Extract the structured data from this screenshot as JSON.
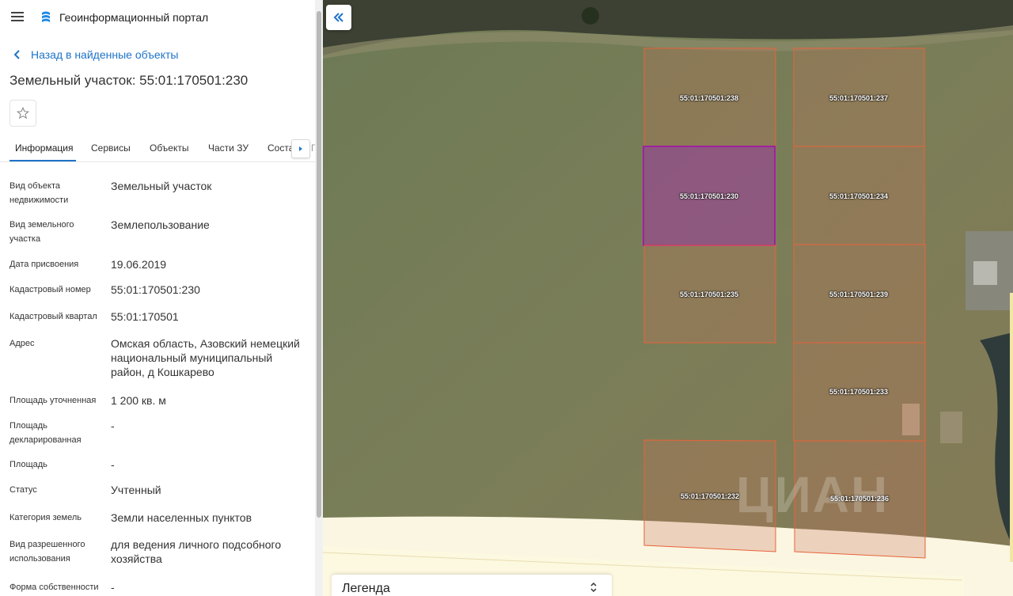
{
  "header": {
    "app_title": "Геоинформационный портал"
  },
  "nav": {
    "back_label": "Назад в найденные объекты"
  },
  "object": {
    "title": "Земельный участок: 55:01:170501:230"
  },
  "tabs": [
    {
      "label": "Информация",
      "active": true
    },
    {
      "label": "Сервисы"
    },
    {
      "label": "Объекты"
    },
    {
      "label": "Части ЗУ"
    },
    {
      "label": "Соста"
    }
  ],
  "tab_peek": "Г",
  "properties": [
    {
      "label": "Вид объекта недвижимости",
      "value": "Земельный участок"
    },
    {
      "label": "Вид земельного участка",
      "value": "Землепользование"
    },
    {
      "label": "Дата присвоения",
      "value": "19.06.2019"
    },
    {
      "label": "Кадастровый номер",
      "value": "55:01:170501:230"
    },
    {
      "label": "Кадастровый квартал",
      "value": "55:01:170501"
    },
    {
      "label": "Адрес",
      "value": "Омская область, Азовский немецкий национальный муниципальный район, д Кошкарево"
    },
    {
      "label": "Площадь уточненная",
      "value": "1 200 кв. м"
    },
    {
      "label": "Площадь декларированная",
      "value": "-"
    },
    {
      "label": "Площадь",
      "value": "-"
    },
    {
      "label": "Статус",
      "value": "Учтенный"
    },
    {
      "label": "Категория земель",
      "value": "Земли населенных пунктов"
    },
    {
      "label": "Вид разрешенного использования",
      "value": "для ведения личного подсобного хозяйства"
    },
    {
      "label": "Форма собственности",
      "value": "-"
    }
  ],
  "parcels": [
    {
      "id": "55:01:170501:238",
      "selected": false
    },
    {
      "id": "55:01:170501:237",
      "selected": false
    },
    {
      "id": "55:01:170501:230",
      "selected": true
    },
    {
      "id": "55:01:170501:234",
      "selected": false
    },
    {
      "id": "55:01:170501:235",
      "selected": false
    },
    {
      "id": "55:01:170501:239",
      "selected": false
    },
    {
      "id": "55:01:170501:233",
      "selected": false
    },
    {
      "id": "55:01:170501:232",
      "selected": false
    },
    {
      "id": "55:01:170501:236",
      "selected": false
    }
  ],
  "legend": {
    "label": "Легенда"
  },
  "watermark": "ЦИАН",
  "colors": {
    "accent": "#1e73c9",
    "parcel_stroke": "#e8633a",
    "selected_stroke": "#a020a0"
  },
  "icons": [
    "hamburger-icon",
    "logo-icon",
    "chevron-left-icon",
    "star-icon",
    "chevron-right-icon",
    "double-chevron-left-icon",
    "sort-arrows-icon"
  ]
}
